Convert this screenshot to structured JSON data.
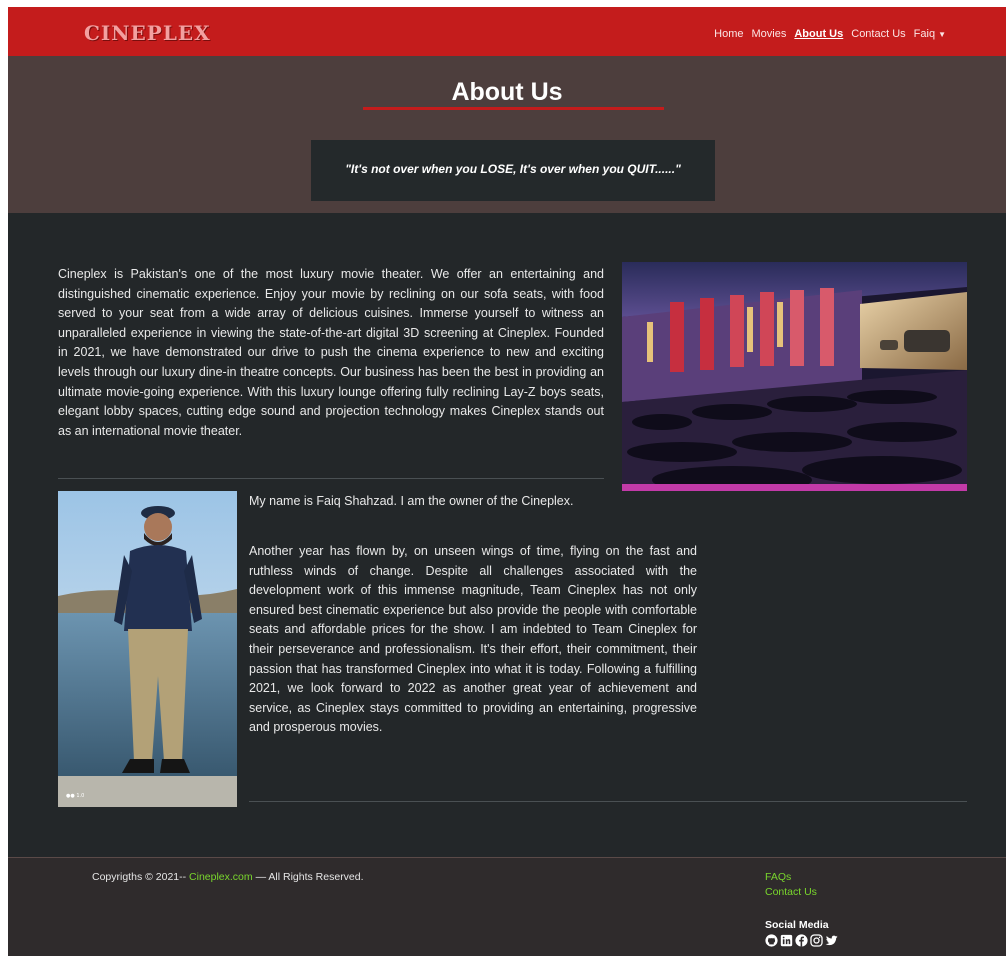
{
  "brand": "CINEPLEX",
  "nav": {
    "items": [
      "Home",
      "Movies",
      "About Us",
      "Contact Us"
    ],
    "active": "About Us",
    "user": "Faiq"
  },
  "hero": {
    "title": "About Us",
    "quote": "\"It's not over when you LOSE, It's over when you QUIT......\""
  },
  "about": {
    "intro": "Cineplex is Pakistan's one of the most luxury movie theater. We offer an entertaining and distinguished cinematic experience. Enjoy your movie by reclining on our sofa seats, with food served to your seat from a wide array of delicious cuisines. Immerse yourself to witness an unparalleled experience in viewing the state-of-the-art digital 3D screening at Cineplex. Founded in 2021, we have demonstrated our drive to push the cinema experience to new and exciting levels through our luxury dine-in theatre concepts. Our business has been the best in providing an ultimate movie-going experience. With this luxury lounge offering fully reclining Lay-Z boys seats, elegant lobby spaces, cutting edge sound and projection technology makes Cineplex stands out as an international movie theater.",
    "owner_intro": "My name is Faiq Shahzad. I am the owner of the Cineplex.",
    "owner_message": "Another year has flown by, on unseen wings of time, flying on the fast and ruthless winds of change. Despite all challenges associated with the development work of this immense magnitude, Team Cineplex has not only ensured best cinematic experience but also provide the people with comfortable seats and affordable prices for the show. I am indebted to Team Cineplex for their perseverance and professionalism. It's their effort, their commitment, their passion that has transformed Cineplex into what it is today. Following a fulfilling 2021, we look forward to 2022 as another great year of achievement and service, as Cineplex stays committed to providing an entertaining, progressive and prosperous movies."
  },
  "footer": {
    "copyright_prefix": "Copyrigths © 2021-- ",
    "copyright_link": "Cineplex.com",
    "copyright_suffix": " — All Rights Reserved.",
    "links": [
      "FAQs",
      "Contact Us"
    ],
    "social_title": "Social Media",
    "social_icons": [
      "github-icon",
      "linkedin-icon",
      "facebook-icon",
      "instagram-icon",
      "twitter-icon"
    ]
  },
  "colors": {
    "navbar": "#c41c1c",
    "hero": "#4d3e3d",
    "body": "#232729",
    "footer": "#2f2b2c",
    "link_green": "#79d62d"
  }
}
